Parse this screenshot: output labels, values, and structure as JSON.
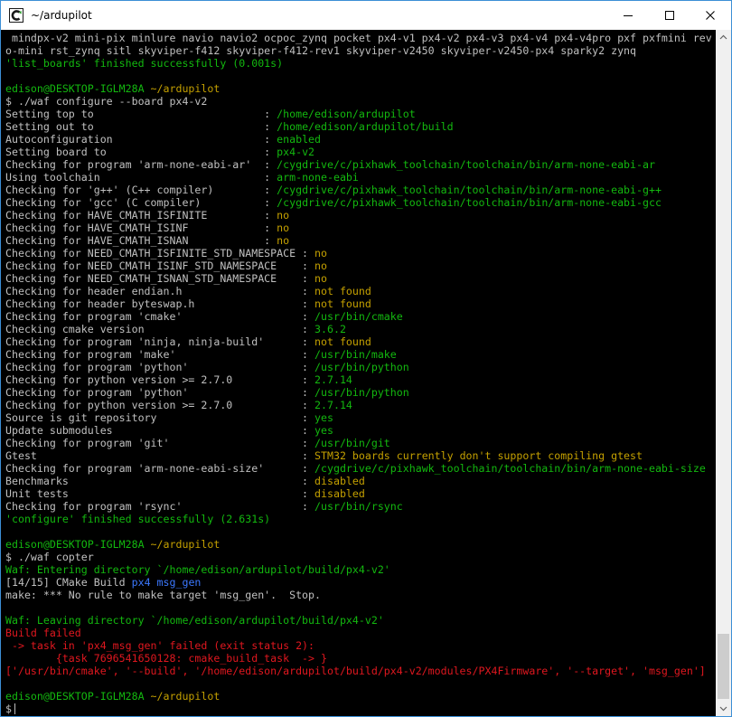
{
  "window": {
    "title": "~/ardupilot",
    "icon": "cygwin-terminal-icon",
    "controls": [
      "minimize-icon",
      "maximize-icon",
      "close-icon"
    ]
  },
  "colors": {
    "background": "#000000",
    "default_text": "#c0c0c0",
    "green": "#13b80f",
    "yellow": "#c4a000",
    "red": "#e0171f",
    "blue": "#3b78ff",
    "magenta": "#b148c6"
  },
  "terminal": {
    "lines": [
      [
        {
          "t": " mindpx-v2 mini-pix minlure navio navio2 ocpoc_zynq pocket px4-v1 px4-v2 px4-v3 px4-v4 px4-v4pro pxf pxfmini rev",
          "c": "w"
        }
      ],
      [
        {
          "t": "o-mini rst_zynq sitl skyviper-f412 skyviper-f412-rev1 skyviper-v2450 skyviper-v2450-px4 sparky2 zynq",
          "c": "w"
        }
      ],
      [
        {
          "t": "'list_boards' finished successfully (0.001s)",
          "c": "g"
        }
      ],
      [],
      [
        {
          "t": "edison@DESKTOP-IGLM28A",
          "c": "g"
        },
        {
          "t": " ",
          "c": "w"
        },
        {
          "t": "~/ardupilot",
          "c": "y"
        }
      ],
      [
        {
          "t": "$ ./waf configure --board px4-v2",
          "c": "w"
        }
      ],
      [
        {
          "t": "Setting top to                           : ",
          "c": "w"
        },
        {
          "t": "/home/edison/ardupilot",
          "c": "g"
        }
      ],
      [
        {
          "t": "Setting out to                           : ",
          "c": "w"
        },
        {
          "t": "/home/edison/ardupilot/build",
          "c": "g"
        }
      ],
      [
        {
          "t": "Autoconfiguration                        : ",
          "c": "w"
        },
        {
          "t": "enabled",
          "c": "g"
        }
      ],
      [
        {
          "t": "Setting board to                         : ",
          "c": "w"
        },
        {
          "t": "px4-v2",
          "c": "g"
        }
      ],
      [
        {
          "t": "Checking for program 'arm-none-eabi-ar'  : ",
          "c": "w"
        },
        {
          "t": "/cygdrive/c/pixhawk_toolchain/toolchain/bin/arm-none-eabi-ar",
          "c": "g"
        }
      ],
      [
        {
          "t": "Using toolchain                          : ",
          "c": "w"
        },
        {
          "t": "arm-none-eabi",
          "c": "g"
        }
      ],
      [
        {
          "t": "Checking for 'g++' (C++ compiler)        : ",
          "c": "w"
        },
        {
          "t": "/cygdrive/c/pixhawk_toolchain/toolchain/bin/arm-none-eabi-g++",
          "c": "g"
        }
      ],
      [
        {
          "t": "Checking for 'gcc' (C compiler)          : ",
          "c": "w"
        },
        {
          "t": "/cygdrive/c/pixhawk_toolchain/toolchain/bin/arm-none-eabi-gcc",
          "c": "g"
        }
      ],
      [
        {
          "t": "Checking for HAVE_CMATH_ISFINITE         : ",
          "c": "w"
        },
        {
          "t": "no",
          "c": "y"
        }
      ],
      [
        {
          "t": "Checking for HAVE_CMATH_ISINF            : ",
          "c": "w"
        },
        {
          "t": "no",
          "c": "y"
        }
      ],
      [
        {
          "t": "Checking for HAVE_CMATH_ISNAN            : ",
          "c": "w"
        },
        {
          "t": "no",
          "c": "y"
        }
      ],
      [
        {
          "t": "Checking for NEED_CMATH_ISFINITE_STD_NAMESPACE : ",
          "c": "w"
        },
        {
          "t": "no",
          "c": "y"
        }
      ],
      [
        {
          "t": "Checking for NEED_CMATH_ISINF_STD_NAMESPACE    : ",
          "c": "w"
        },
        {
          "t": "no",
          "c": "y"
        }
      ],
      [
        {
          "t": "Checking for NEED_CMATH_ISNAN_STD_NAMESPACE    : ",
          "c": "w"
        },
        {
          "t": "no",
          "c": "y"
        }
      ],
      [
        {
          "t": "Checking for header endian.h                   : ",
          "c": "w"
        },
        {
          "t": "not found",
          "c": "y"
        }
      ],
      [
        {
          "t": "Checking for header byteswap.h                 : ",
          "c": "w"
        },
        {
          "t": "not found",
          "c": "y"
        }
      ],
      [
        {
          "t": "Checking for program 'cmake'                   : ",
          "c": "w"
        },
        {
          "t": "/usr/bin/cmake",
          "c": "g"
        }
      ],
      [
        {
          "t": "Checking cmake version                         : ",
          "c": "w"
        },
        {
          "t": "3.6.2",
          "c": "g"
        }
      ],
      [
        {
          "t": "Checking for program 'ninja, ninja-build'      : ",
          "c": "w"
        },
        {
          "t": "not found",
          "c": "y"
        }
      ],
      [
        {
          "t": "Checking for program 'make'                    : ",
          "c": "w"
        },
        {
          "t": "/usr/bin/make",
          "c": "g"
        }
      ],
      [
        {
          "t": "Checking for program 'python'                  : ",
          "c": "w"
        },
        {
          "t": "/usr/bin/python",
          "c": "g"
        }
      ],
      [
        {
          "t": "Checking for python version >= 2.7.0           : ",
          "c": "w"
        },
        {
          "t": "2.7.14",
          "c": "g"
        }
      ],
      [
        {
          "t": "Checking for program 'python'                  : ",
          "c": "w"
        },
        {
          "t": "/usr/bin/python",
          "c": "g"
        }
      ],
      [
        {
          "t": "Checking for python version >= 2.7.0           : ",
          "c": "w"
        },
        {
          "t": "2.7.14",
          "c": "g"
        }
      ],
      [
        {
          "t": "Source is git repository                       : ",
          "c": "w"
        },
        {
          "t": "yes",
          "c": "g"
        }
      ],
      [
        {
          "t": "Update submodules                              : ",
          "c": "w"
        },
        {
          "t": "yes",
          "c": "g"
        }
      ],
      [
        {
          "t": "Checking for program 'git'                     : ",
          "c": "w"
        },
        {
          "t": "/usr/bin/git",
          "c": "g"
        }
      ],
      [
        {
          "t": "Gtest                                          : ",
          "c": "w"
        },
        {
          "t": "STM32 boards currently don't support compiling gtest",
          "c": "y"
        }
      ],
      [
        {
          "t": "Checking for program 'arm-none-eabi-size'      : ",
          "c": "w"
        },
        {
          "t": "/cygdrive/c/pixhawk_toolchain/toolchain/bin/arm-none-eabi-size",
          "c": "g"
        }
      ],
      [
        {
          "t": "Benchmarks                                     : ",
          "c": "w"
        },
        {
          "t": "disabled",
          "c": "y"
        }
      ],
      [
        {
          "t": "Unit tests                                     : ",
          "c": "w"
        },
        {
          "t": "disabled",
          "c": "y"
        }
      ],
      [
        {
          "t": "Checking for program 'rsync'                   : ",
          "c": "w"
        },
        {
          "t": "/usr/bin/rsync",
          "c": "g"
        }
      ],
      [
        {
          "t": "'configure' finished successfully (2.631s)",
          "c": "g"
        }
      ],
      [],
      [
        {
          "t": "edison@DESKTOP-IGLM28A",
          "c": "g"
        },
        {
          "t": " ",
          "c": "w"
        },
        {
          "t": "~/ardupilot",
          "c": "y"
        }
      ],
      [
        {
          "t": "$ ./waf copter",
          "c": "w"
        }
      ],
      [
        {
          "t": "Waf: Entering directory `/home/edison/ardupilot/build/px4-v2'",
          "c": "g"
        }
      ],
      [
        {
          "t": "[14/15] CMake Build ",
          "c": "w"
        },
        {
          "t": "px4",
          "c": "b"
        },
        {
          "t": " ",
          "c": "w"
        },
        {
          "t": "msg_gen",
          "c": "b"
        }
      ],
      [
        {
          "t": "make: *** No rule to make target 'msg_gen'.  Stop.",
          "c": "w"
        }
      ],
      [],
      [
        {
          "t": "Waf: Leaving directory `/home/edison/ardupilot/build/px4-v2'",
          "c": "g"
        }
      ],
      [
        {
          "t": "Build failed",
          "c": "r"
        }
      ],
      [
        {
          "t": " -> task in 'px4_msg_gen' failed (exit status 2):",
          "c": "r"
        }
      ],
      [
        {
          "t": "        {task 7696541650128: cmake_build_task  -> }",
          "c": "r"
        }
      ],
      [
        {
          "t": "['/usr/bin/cmake', '--build', '/home/edison/ardupilot/build/px4-v2/modules/PX4Firmware', '--target', 'msg_gen']",
          "c": "r"
        }
      ],
      [],
      [
        {
          "t": "edison@DESKTOP-IGLM28A",
          "c": "g"
        },
        {
          "t": " ",
          "c": "w"
        },
        {
          "t": "~/ardupilot",
          "c": "y"
        }
      ],
      [
        {
          "t": "$",
          "c": "w"
        }
      ]
    ]
  },
  "scrollbar": {
    "up_icon": "scroll-up-arrow-icon",
    "down_icon": "scroll-down-arrow-icon",
    "position": "bottom"
  }
}
